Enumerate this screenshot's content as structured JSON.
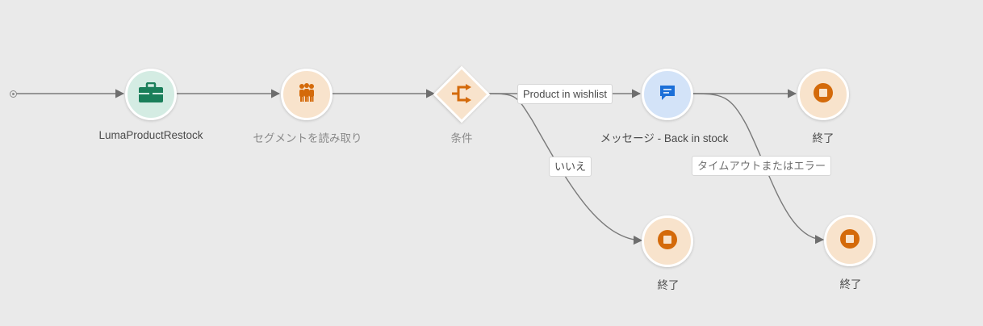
{
  "journey": {
    "nodes": {
      "event": {
        "label": "LumaProductRestock",
        "icon": "briefcase-icon",
        "color": "#1a7f5a"
      },
      "segment": {
        "label": "セグメントを読み取り",
        "icon": "audience-icon",
        "color": "#d46a0a"
      },
      "condition": {
        "label": "条件",
        "icon": "split-icon",
        "color": "#d46a0a"
      },
      "message": {
        "label": "メッセージ - Back in stock",
        "icon": "chat-bubble-icon",
        "color": "#1b6fd8"
      },
      "end1": {
        "label": "終了",
        "icon": "stop-icon",
        "color": "#d46a0a"
      },
      "end2": {
        "label": "終了",
        "icon": "stop-icon",
        "color": "#d46a0a"
      },
      "end3": {
        "label": "終了",
        "icon": "stop-icon",
        "color": "#d46a0a"
      }
    },
    "edges": {
      "wishlist_label": "Product in wishlist",
      "no_label": "いいえ",
      "timeout_label": "タイムアウトまたはエラー"
    }
  }
}
